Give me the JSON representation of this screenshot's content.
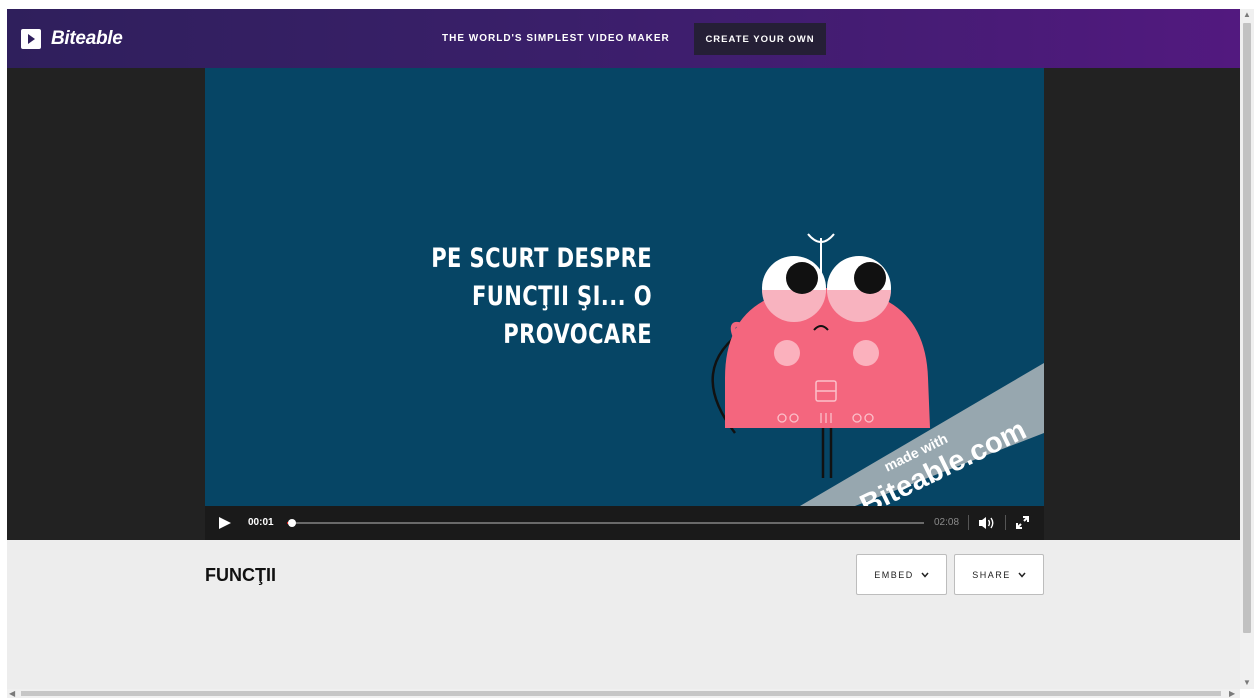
{
  "header": {
    "brand": "Biteable",
    "tagline": "THE WORLD'S SIMPLEST VIDEO MAKER",
    "cta_label": "CREATE YOUR OWN"
  },
  "video": {
    "slide_title": "PE SCURT DESPRE FUNCŢII ŞI... O PROVOCARE",
    "watermark_prefix": "made with",
    "watermark_domain": "Biteable.com",
    "current_time": "00:01",
    "total_time": "02:08",
    "progress_fraction": 0.008
  },
  "page": {
    "video_title": "FUNCŢII",
    "embed_label": "EMBED",
    "share_label": "SHARE"
  },
  "colors": {
    "header_start": "#2f1f5c",
    "header_end": "#52197f",
    "video_bg": "#064565",
    "mascot": "#f4667e",
    "progress": "#e02020"
  }
}
